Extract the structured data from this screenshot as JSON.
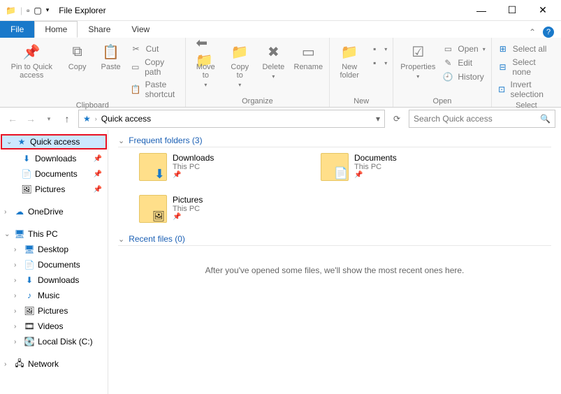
{
  "window": {
    "title": "File Explorer"
  },
  "tabs": {
    "file": "File",
    "home": "Home",
    "share": "Share",
    "view": "View"
  },
  "ribbon": {
    "pin": "Pin to Quick access",
    "copy": "Copy",
    "paste": "Paste",
    "cut": "Cut",
    "copypath": "Copy path",
    "pasteshort": "Paste shortcut",
    "clipboard": "Clipboard",
    "moveto": "Move to",
    "copyto": "Copy to",
    "delete": "Delete",
    "rename": "Rename",
    "organize": "Organize",
    "newfolder": "New folder",
    "new": "New",
    "properties": "Properties",
    "open": "Open",
    "edit": "Edit",
    "history": "History",
    "openg": "Open",
    "selectall": "Select all",
    "selectnone": "Select none",
    "invert": "Invert selection",
    "select": "Select"
  },
  "address": {
    "location": "Quick access",
    "search_placeholder": "Search Quick access"
  },
  "sidebar": {
    "quick": "Quick access",
    "downloads": "Downloads",
    "documents": "Documents",
    "pictures": "Pictures",
    "onedrive": "OneDrive",
    "thispc": "This PC",
    "desktop": "Desktop",
    "documents2": "Documents",
    "downloads2": "Downloads",
    "music": "Music",
    "pictures2": "Pictures",
    "videos": "Videos",
    "localdisk": "Local Disk (C:)",
    "network": "Network"
  },
  "content": {
    "frequent": "Frequent folders (3)",
    "folders": [
      {
        "name": "Downloads",
        "sub": "This PC",
        "cls": "dl"
      },
      {
        "name": "Documents",
        "sub": "This PC",
        "cls": "doc"
      },
      {
        "name": "Pictures",
        "sub": "This PC",
        "cls": "pic"
      }
    ],
    "recent": "Recent files (0)",
    "empty": "After you've opened some files, we'll show the most recent ones here."
  }
}
